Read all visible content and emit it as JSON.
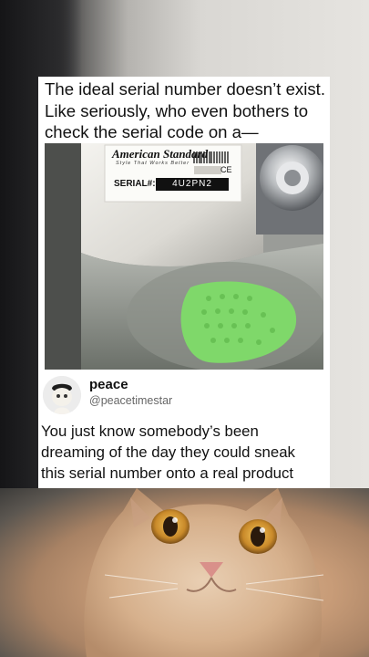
{
  "post": {
    "caption": "The ideal serial number doesn’t exist.\nLike seriously, who even bothers to\ncheck the serial code on a—",
    "photo": {
      "brand": "American Standard",
      "tagline": "Style That Works Better",
      "serial_label": "SERIAL#:",
      "serial_value": "4U2PN2",
      "ce_mark": "CE"
    },
    "author": {
      "name": "peace",
      "handle": "@peacetimestar"
    },
    "body": "You just know somebody’s been\ndreaming of the day they could sneak\nthis serial number onto a real product"
  },
  "colors": {
    "card_bg": "#ffffff",
    "text": "#111111",
    "handle": "#666666",
    "urinal_screen": "#7fd86a"
  }
}
